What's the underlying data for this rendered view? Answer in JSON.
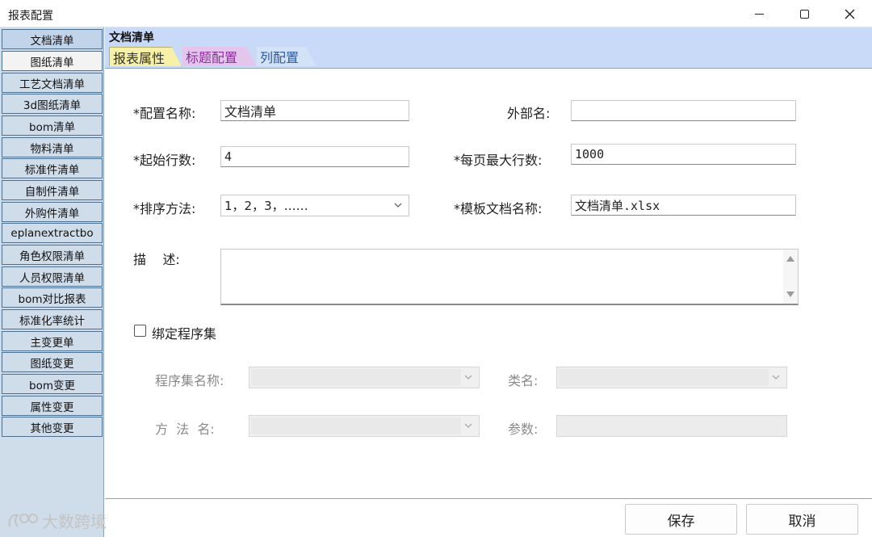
{
  "window": {
    "title": "报表配置"
  },
  "sidebar": {
    "items": [
      {
        "label": "文档清单"
      },
      {
        "label": "图纸清单"
      },
      {
        "label": "工艺文档清单"
      },
      {
        "label": "3d图纸清单"
      },
      {
        "label": "bom清单"
      },
      {
        "label": "物料清单"
      },
      {
        "label": "标准件清单"
      },
      {
        "label": "自制件清单"
      },
      {
        "label": "外购件清单"
      },
      {
        "label": "eplanextractbo"
      },
      {
        "label": "角色权限清单"
      },
      {
        "label": "人员权限清单"
      },
      {
        "label": "bom对比报表"
      },
      {
        "label": "标准化率统计"
      },
      {
        "label": "主变更单"
      },
      {
        "label": "图纸变更"
      },
      {
        "label": "bom变更"
      },
      {
        "label": "属性变更"
      },
      {
        "label": "其他变更"
      }
    ]
  },
  "panel": {
    "title": "文档清单",
    "tabs": [
      {
        "label": "报表属性"
      },
      {
        "label": "标题配置"
      },
      {
        "label": "列配置"
      }
    ]
  },
  "form": {
    "config_name_label": "*配置名称:",
    "config_name_value": "文档清单",
    "external_name_label": "外部名:",
    "external_name_value": "",
    "start_row_label": "*起始行数:",
    "start_row_value": "4",
    "max_rows_label": "*每页最大行数:",
    "max_rows_value": "1000",
    "sort_method_label": "*排序方法:",
    "sort_method_value": "1，2，3，……",
    "template_label": "*模板文档名称:",
    "template_value": "文档清单.xlsx",
    "desc_label": "描    述:",
    "bind_label": "绑定程序集",
    "assembly_label": "程序集名称:",
    "class_label": "类名:",
    "method_label": "方  法  名:",
    "param_label": "参数:"
  },
  "footer": {
    "save_label": "保存",
    "cancel_label": "取消"
  },
  "watermark": {
    "text": "大数跨境"
  }
}
